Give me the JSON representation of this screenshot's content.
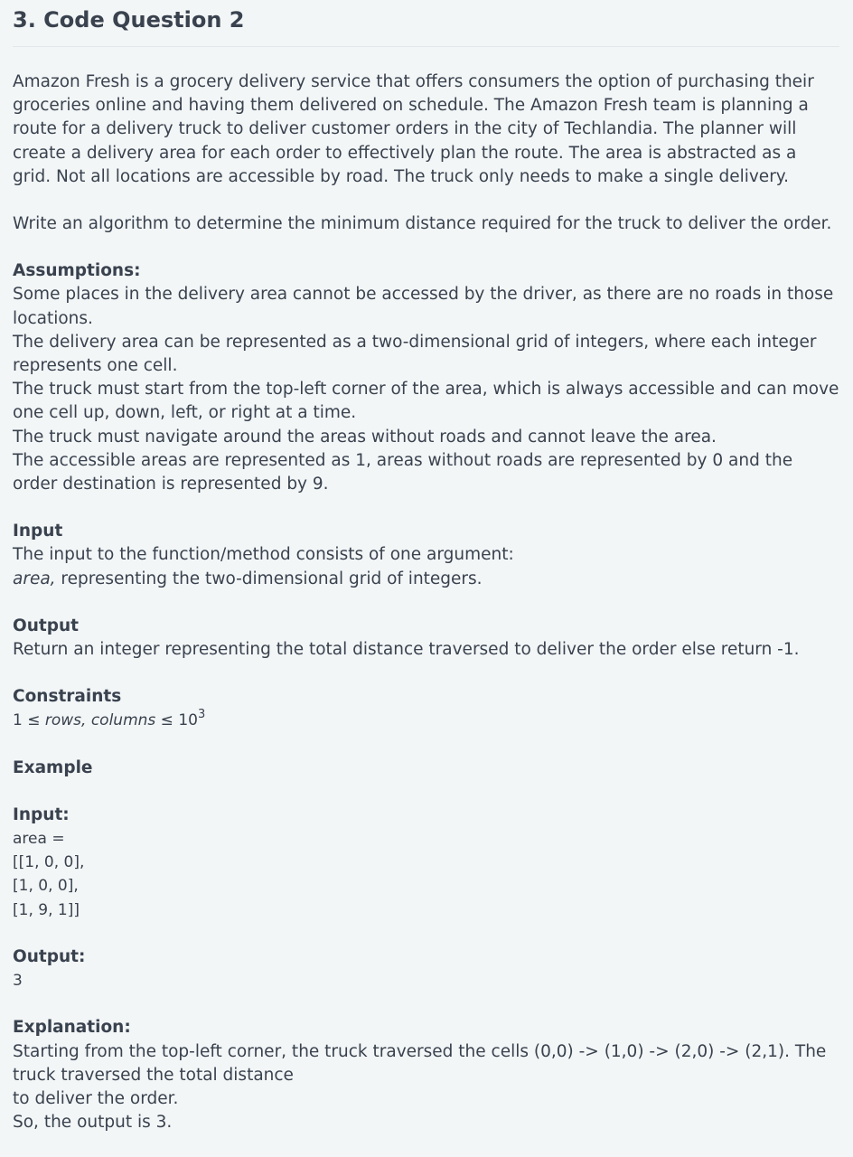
{
  "title": "3. Code Question 2",
  "intro": "Amazon Fresh is a grocery delivery service that offers consumers the option of purchasing their groceries online and having them delivered on schedule.  The Amazon Fresh team is planning a route for a delivery truck to deliver customer orders in the city of Techlandia.  The planner will create a delivery area for each order to effectively plan the route. The area is abstracted as a grid. Not all locations are accessible by road. The truck only needs to make a single delivery.",
  "task": "Write an algorithm to determine the minimum distance required for the truck to deliver the order.",
  "assumptions": {
    "heading": "Assumptions:",
    "lines": [
      "Some places in the delivery area cannot be accessed by the driver, as there are no roads in those locations.",
      "The delivery area can be represented as a two-dimensional grid of integers, where each integer represents one cell.",
      "The truck must start from the top-left corner of the area, which is always accessible and can move one cell up, down, left, or right at a time.",
      "The truck must navigate around the areas without roads and cannot leave the area.",
      "The accessible areas are represented as 1, areas without roads are represented by 0 and the order destination is represented by 9."
    ]
  },
  "input": {
    "heading": "Input",
    "line1": "The input to the function/method consists of one argument:",
    "arg_name": "area,",
    "arg_desc": " representing the two-dimensional grid of integers."
  },
  "output": {
    "heading": "Output",
    "line": "Return an integer representing the total distance traversed to deliver the order else return -1."
  },
  "constraints": {
    "heading": "Constraints",
    "prefix": "1 ≤ ",
    "vars": "rows, columns",
    "le": " ≤ 10",
    "exp": "3"
  },
  "example": {
    "heading": "Example",
    "input_heading": "Input:",
    "area_label": "area =",
    "rows": [
      "[[1, 0, 0],",
      "[1, 0, 0],",
      "[1, 9, 1]]"
    ],
    "output_heading": "Output:",
    "output_value": "3",
    "explanation_heading": "Explanation:",
    "explanation_lines": [
      "Starting from the top-left corner, the truck traversed the cells (0,0) -> (1,0) -> (2,0) -> (2,1). The truck traversed the total distance",
      "to deliver the order.",
      "So, the output is 3."
    ]
  }
}
